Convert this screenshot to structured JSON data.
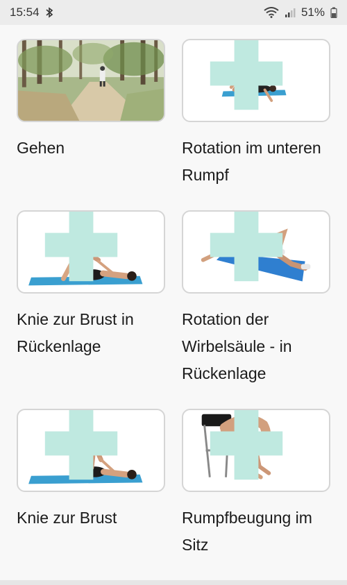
{
  "status_bar": {
    "time": "15:54",
    "battery": "51%"
  },
  "exercises": [
    {
      "label": "Gehen",
      "image": "forest-path-walking"
    },
    {
      "label": "Rotation im unteren Rumpf",
      "image": "lower-trunk-rotation"
    },
    {
      "label": "Knie zur Brust in Rückenlage",
      "image": "knee-to-chest-supine"
    },
    {
      "label": "Rotation der Wirbelsäule - in Rückenlage",
      "image": "spinal-rotation-supine"
    },
    {
      "label": "Knie zur Brust",
      "image": "knee-to-chest"
    },
    {
      "label": "Rumpfbeugung im Sitz",
      "image": "seated-trunk-flexion"
    }
  ],
  "colors": {
    "mat": "#3a9fd0",
    "add_icon": "#bfe9e0"
  }
}
